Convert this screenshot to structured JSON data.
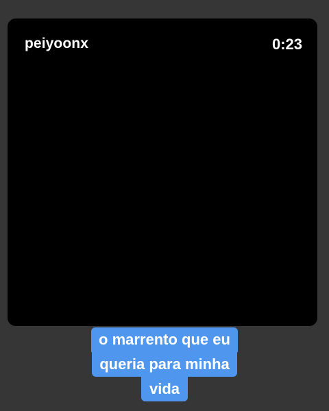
{
  "video": {
    "username": "peiyoonx",
    "timestamp": "0:23"
  },
  "caption": {
    "lines": [
      "o marrento que eu",
      "queria para minha",
      "vida"
    ],
    "background_color": "#4f97ee",
    "text_color": "#ffffff"
  },
  "colors": {
    "page_background": "#363636",
    "video_background": "#000000"
  }
}
